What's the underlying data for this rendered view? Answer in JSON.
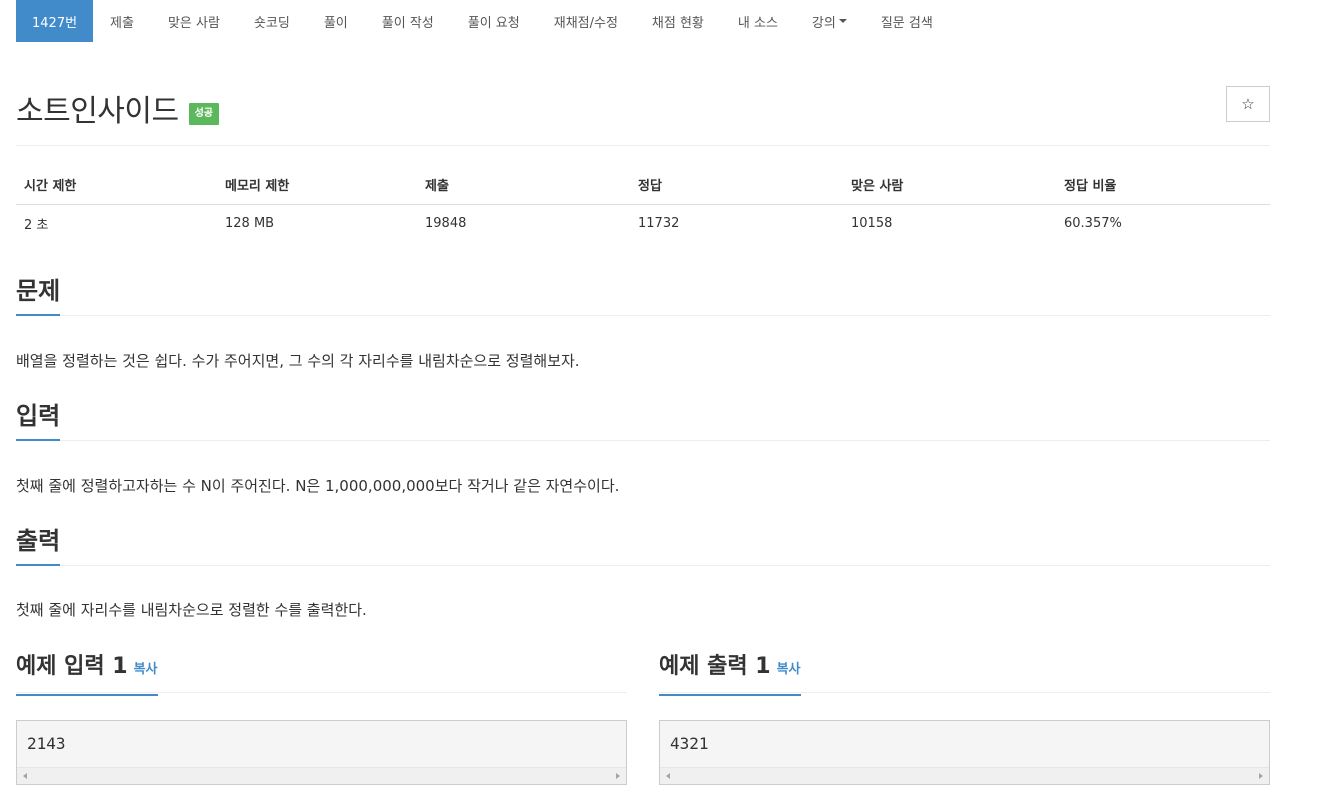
{
  "nav": {
    "items": [
      {
        "label": "1427번",
        "active": true
      },
      {
        "label": "제출"
      },
      {
        "label": "맞은 사람"
      },
      {
        "label": "숏코딩"
      },
      {
        "label": "풀이"
      },
      {
        "label": "풀이 작성"
      },
      {
        "label": "풀이 요청"
      },
      {
        "label": "재채점/수정"
      },
      {
        "label": "채점 현황"
      },
      {
        "label": "내 소스"
      },
      {
        "label": "강의",
        "dropdown": true
      },
      {
        "label": "질문 검색"
      }
    ]
  },
  "problem": {
    "title": "소트인사이드",
    "badge": "성공",
    "star": "☆"
  },
  "stats": {
    "headers": [
      "시간 제한",
      "메모리 제한",
      "제출",
      "정답",
      "맞은 사람",
      "정답 비율"
    ],
    "values": [
      "2 초",
      "128 MB",
      "19848",
      "11732",
      "10158",
      "60.357%"
    ]
  },
  "sections": {
    "problem": {
      "heading": "문제",
      "body": "배열을 정렬하는 것은 쉽다. 수가 주어지면, 그 수의 각 자리수를 내림차순으로 정렬해보자."
    },
    "input": {
      "heading": "입력",
      "body": "첫째 줄에 정렬하고자하는 수 N이 주어진다. N은 1,000,000,000보다 작거나 같은 자연수이다."
    },
    "output": {
      "heading": "출력",
      "body": "첫째 줄에 자리수를 내림차순으로 정렬한 수를 출력한다."
    }
  },
  "examples": {
    "input": {
      "heading": "예제 입력 1",
      "copy": "복사",
      "value": "2143"
    },
    "output": {
      "heading": "예제 출력 1",
      "copy": "복사",
      "value": "4321"
    }
  },
  "colors": {
    "accent": "#428bca",
    "success": "#5cb85c"
  }
}
